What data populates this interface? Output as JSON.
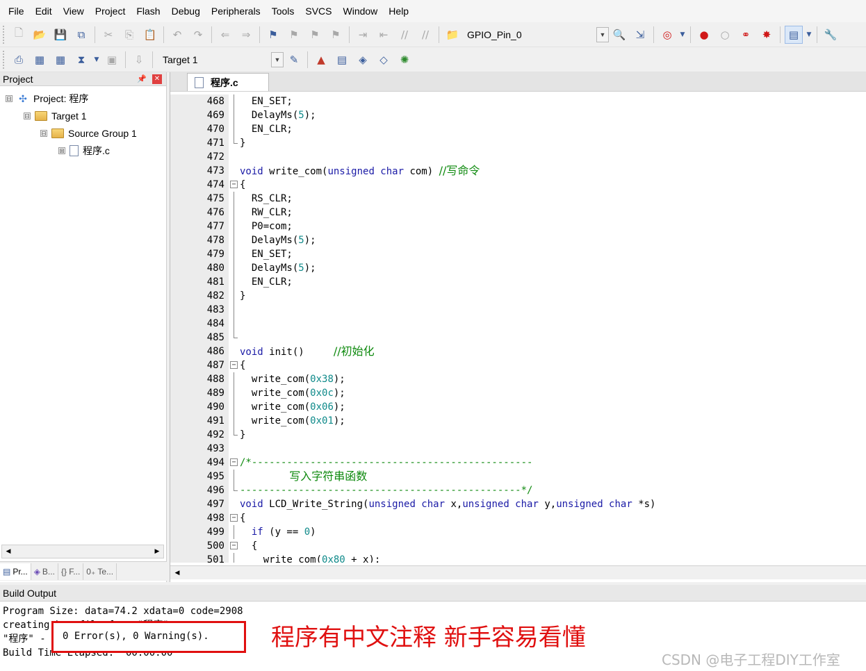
{
  "menu": [
    "File",
    "Edit",
    "View",
    "Project",
    "Flash",
    "Debug",
    "Peripherals",
    "Tools",
    "SVCS",
    "Window",
    "Help"
  ],
  "toolbar": {
    "gpio_combo": "GPIO_Pin_0",
    "target_combo": "Target 1"
  },
  "project_panel": {
    "title": "Project",
    "tree": [
      {
        "label": "Project: 程序",
        "level": 0,
        "icon": "project-icon",
        "expander": "⊟"
      },
      {
        "label": "Target 1",
        "level": 1,
        "icon": "target-folder-icon",
        "expander": "⊟"
      },
      {
        "label": "Source Group 1",
        "level": 2,
        "icon": "folder-icon",
        "expander": "⊟"
      },
      {
        "label": "程序.c",
        "level": 3,
        "icon": "file-icon",
        "expander": "⊞"
      }
    ],
    "tabs": [
      "Pr...",
      "B...",
      "{} F...",
      "0₊ Te..."
    ]
  },
  "editor": {
    "tab_label": "程序.c",
    "lines": [
      {
        "n": "468",
        "fold": "line",
        "parts": [
          [
            "  EN_SET;",
            ""
          ]
        ]
      },
      {
        "n": "469",
        "fold": "line",
        "parts": [
          [
            "  DelayMs(",
            ""
          ],
          [
            "5",
            "num"
          ],
          [
            ");",
            ""
          ]
        ]
      },
      {
        "n": "470",
        "fold": "line",
        "parts": [
          [
            "  EN_CLR;",
            ""
          ]
        ]
      },
      {
        "n": "471",
        "fold": "end",
        "parts": [
          [
            "}",
            ""
          ]
        ]
      },
      {
        "n": "472",
        "fold": "",
        "parts": [
          [
            "",
            ""
          ]
        ]
      },
      {
        "n": "473",
        "fold": "",
        "parts": [
          [
            "void",
            "kw"
          ],
          [
            " write_com(",
            ""
          ],
          [
            "unsigned char",
            "kw"
          ],
          [
            " com) ",
            ""
          ],
          [
            "//写命令",
            "cm"
          ]
        ]
      },
      {
        "n": "474",
        "fold": "box",
        "parts": [
          [
            "{",
            ""
          ]
        ]
      },
      {
        "n": "475",
        "fold": "line",
        "parts": [
          [
            "  RS_CLR;",
            ""
          ]
        ]
      },
      {
        "n": "476",
        "fold": "line",
        "parts": [
          [
            "  RW_CLR;",
            ""
          ]
        ]
      },
      {
        "n": "477",
        "fold": "line",
        "parts": [
          [
            "  P0=com;",
            ""
          ]
        ]
      },
      {
        "n": "478",
        "fold": "line",
        "parts": [
          [
            "  DelayMs(",
            ""
          ],
          [
            "5",
            "num"
          ],
          [
            ");",
            ""
          ]
        ]
      },
      {
        "n": "479",
        "fold": "line",
        "parts": [
          [
            "  EN_SET;",
            ""
          ]
        ]
      },
      {
        "n": "480",
        "fold": "line",
        "parts": [
          [
            "  DelayMs(",
            ""
          ],
          [
            "5",
            "num"
          ],
          [
            ");",
            ""
          ]
        ]
      },
      {
        "n": "481",
        "fold": "line",
        "parts": [
          [
            "  EN_CLR;",
            ""
          ]
        ]
      },
      {
        "n": "482",
        "fold": "line",
        "parts": [
          [
            "}",
            ""
          ]
        ]
      },
      {
        "n": "483",
        "fold": "line",
        "parts": [
          [
            "",
            ""
          ]
        ]
      },
      {
        "n": "484",
        "fold": "line",
        "parts": [
          [
            "",
            ""
          ]
        ]
      },
      {
        "n": "485",
        "fold": "end",
        "parts": [
          [
            "",
            ""
          ]
        ]
      },
      {
        "n": "486",
        "fold": "",
        "parts": [
          [
            "void",
            "kw"
          ],
          [
            " init()     ",
            ""
          ],
          [
            "//初始化",
            "cm"
          ]
        ]
      },
      {
        "n": "487",
        "fold": "box",
        "parts": [
          [
            "{",
            ""
          ]
        ]
      },
      {
        "n": "488",
        "fold": "line",
        "parts": [
          [
            "  write_com(",
            ""
          ],
          [
            "0x38",
            "num"
          ],
          [
            ");",
            ""
          ]
        ]
      },
      {
        "n": "489",
        "fold": "line",
        "parts": [
          [
            "  write_com(",
            ""
          ],
          [
            "0x0c",
            "num"
          ],
          [
            ");",
            ""
          ]
        ]
      },
      {
        "n": "490",
        "fold": "line",
        "parts": [
          [
            "  write_com(",
            ""
          ],
          [
            "0x06",
            "num"
          ],
          [
            ");",
            ""
          ]
        ]
      },
      {
        "n": "491",
        "fold": "line",
        "parts": [
          [
            "  write_com(",
            ""
          ],
          [
            "0x01",
            "num"
          ],
          [
            ");",
            ""
          ]
        ]
      },
      {
        "n": "492",
        "fold": "end",
        "parts": [
          [
            "}",
            ""
          ]
        ]
      },
      {
        "n": "493",
        "fold": "",
        "parts": [
          [
            "",
            ""
          ]
        ]
      },
      {
        "n": "494",
        "fold": "box",
        "parts": [
          [
            "/*------------------------------------------------",
            "cm-mono"
          ]
        ]
      },
      {
        "n": "495",
        "fold": "line",
        "parts": [
          [
            "              写入字符串函数",
            "cm"
          ]
        ]
      },
      {
        "n": "496",
        "fold": "end",
        "parts": [
          [
            "------------------------------------------------*/",
            "cm-mono"
          ]
        ]
      },
      {
        "n": "497",
        "fold": "",
        "parts": [
          [
            "void",
            "kw"
          ],
          [
            " LCD_Write_String(",
            ""
          ],
          [
            "unsigned char",
            "kw"
          ],
          [
            " x,",
            ""
          ],
          [
            "unsigned char",
            "kw"
          ],
          [
            " y,",
            ""
          ],
          [
            "unsigned char",
            "kw"
          ],
          [
            " *s)",
            ""
          ]
        ]
      },
      {
        "n": "498",
        "fold": "box",
        "parts": [
          [
            "{",
            ""
          ]
        ]
      },
      {
        "n": "499",
        "fold": "line",
        "parts": [
          [
            "  ",
            ""
          ],
          [
            "if",
            "kw"
          ],
          [
            " (y == ",
            ""
          ],
          [
            "0",
            "num"
          ],
          [
            ")",
            ""
          ]
        ]
      },
      {
        "n": "500",
        "fold": "box",
        "parts": [
          [
            "  {",
            ""
          ]
        ]
      },
      {
        "n": "501",
        "fold": "line",
        "parts": [
          [
            "    write_com(",
            ""
          ],
          [
            "0x80",
            "num"
          ],
          [
            " + x);",
            ""
          ]
        ]
      }
    ]
  },
  "build_output": {
    "title": "Build Output",
    "line1": "Program Size: data=74.2 xdata=0 code=2908",
    "line2": "creating hex file from \"程序\"...",
    "line3": "\"程序\" - 0 Error(s), 0 Warning(s).",
    "line4": "Build Time Elapsed:  00:00:00",
    "summary": "0 Error(s), 0 Warning(s).",
    "annotation": "程序有中文注释 新手容易看懂",
    "watermark": "CSDN @电子工程DIY工作室"
  }
}
